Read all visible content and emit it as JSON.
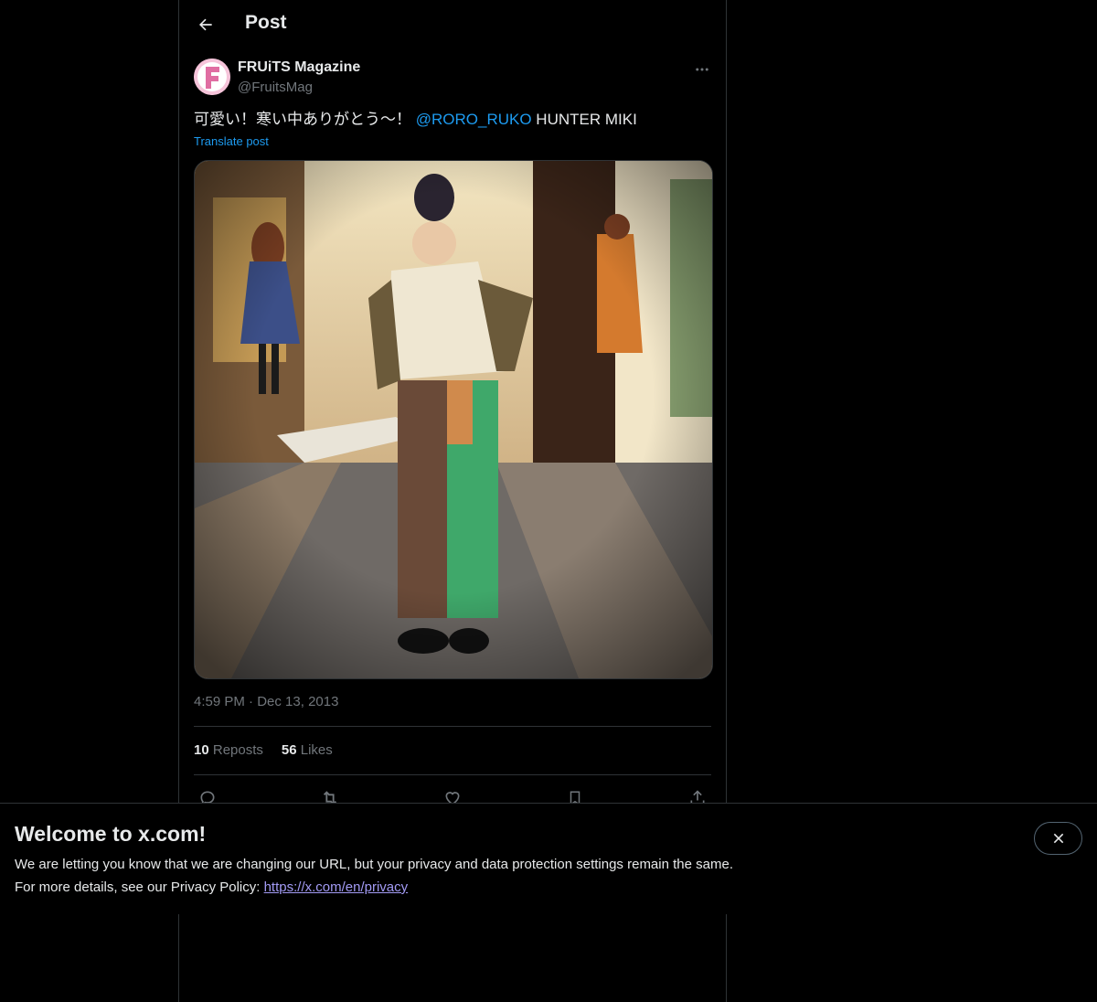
{
  "header": {
    "title": "Post",
    "back_icon": "arrow-left-icon"
  },
  "author": {
    "name": "FRUiTS Magazine",
    "handle": "@FruitsMag",
    "avatar_letter": "F"
  },
  "post": {
    "text_before": "可愛い！寒い中ありがとう〜！ ",
    "mention": "@RORO_RUKO",
    "text_after": " HUNTER MIKI",
    "translate_label": "Translate post",
    "time": "4:59 PM",
    "separator": "·",
    "date": "Dec 13, 2013"
  },
  "stats": {
    "reposts_count": "10",
    "reposts_label": "Reposts",
    "likes_count": "56",
    "likes_label": "Likes"
  },
  "actions": [
    "reply-icon",
    "repost-icon",
    "like-icon",
    "bookmark-icon",
    "share-icon"
  ],
  "banner": {
    "title": "Welcome to x.com!",
    "line1": "We are letting you know that we are changing our URL, but your privacy and data protection settings remain the same.",
    "line2_prefix": "For more details, see our Privacy Policy: ",
    "link": "https://x.com/en/privacy"
  },
  "colors": {
    "accent": "#1d9bf0",
    "muted": "#71767b",
    "border": "#2f3336",
    "link_visited": "#a39bf5"
  }
}
